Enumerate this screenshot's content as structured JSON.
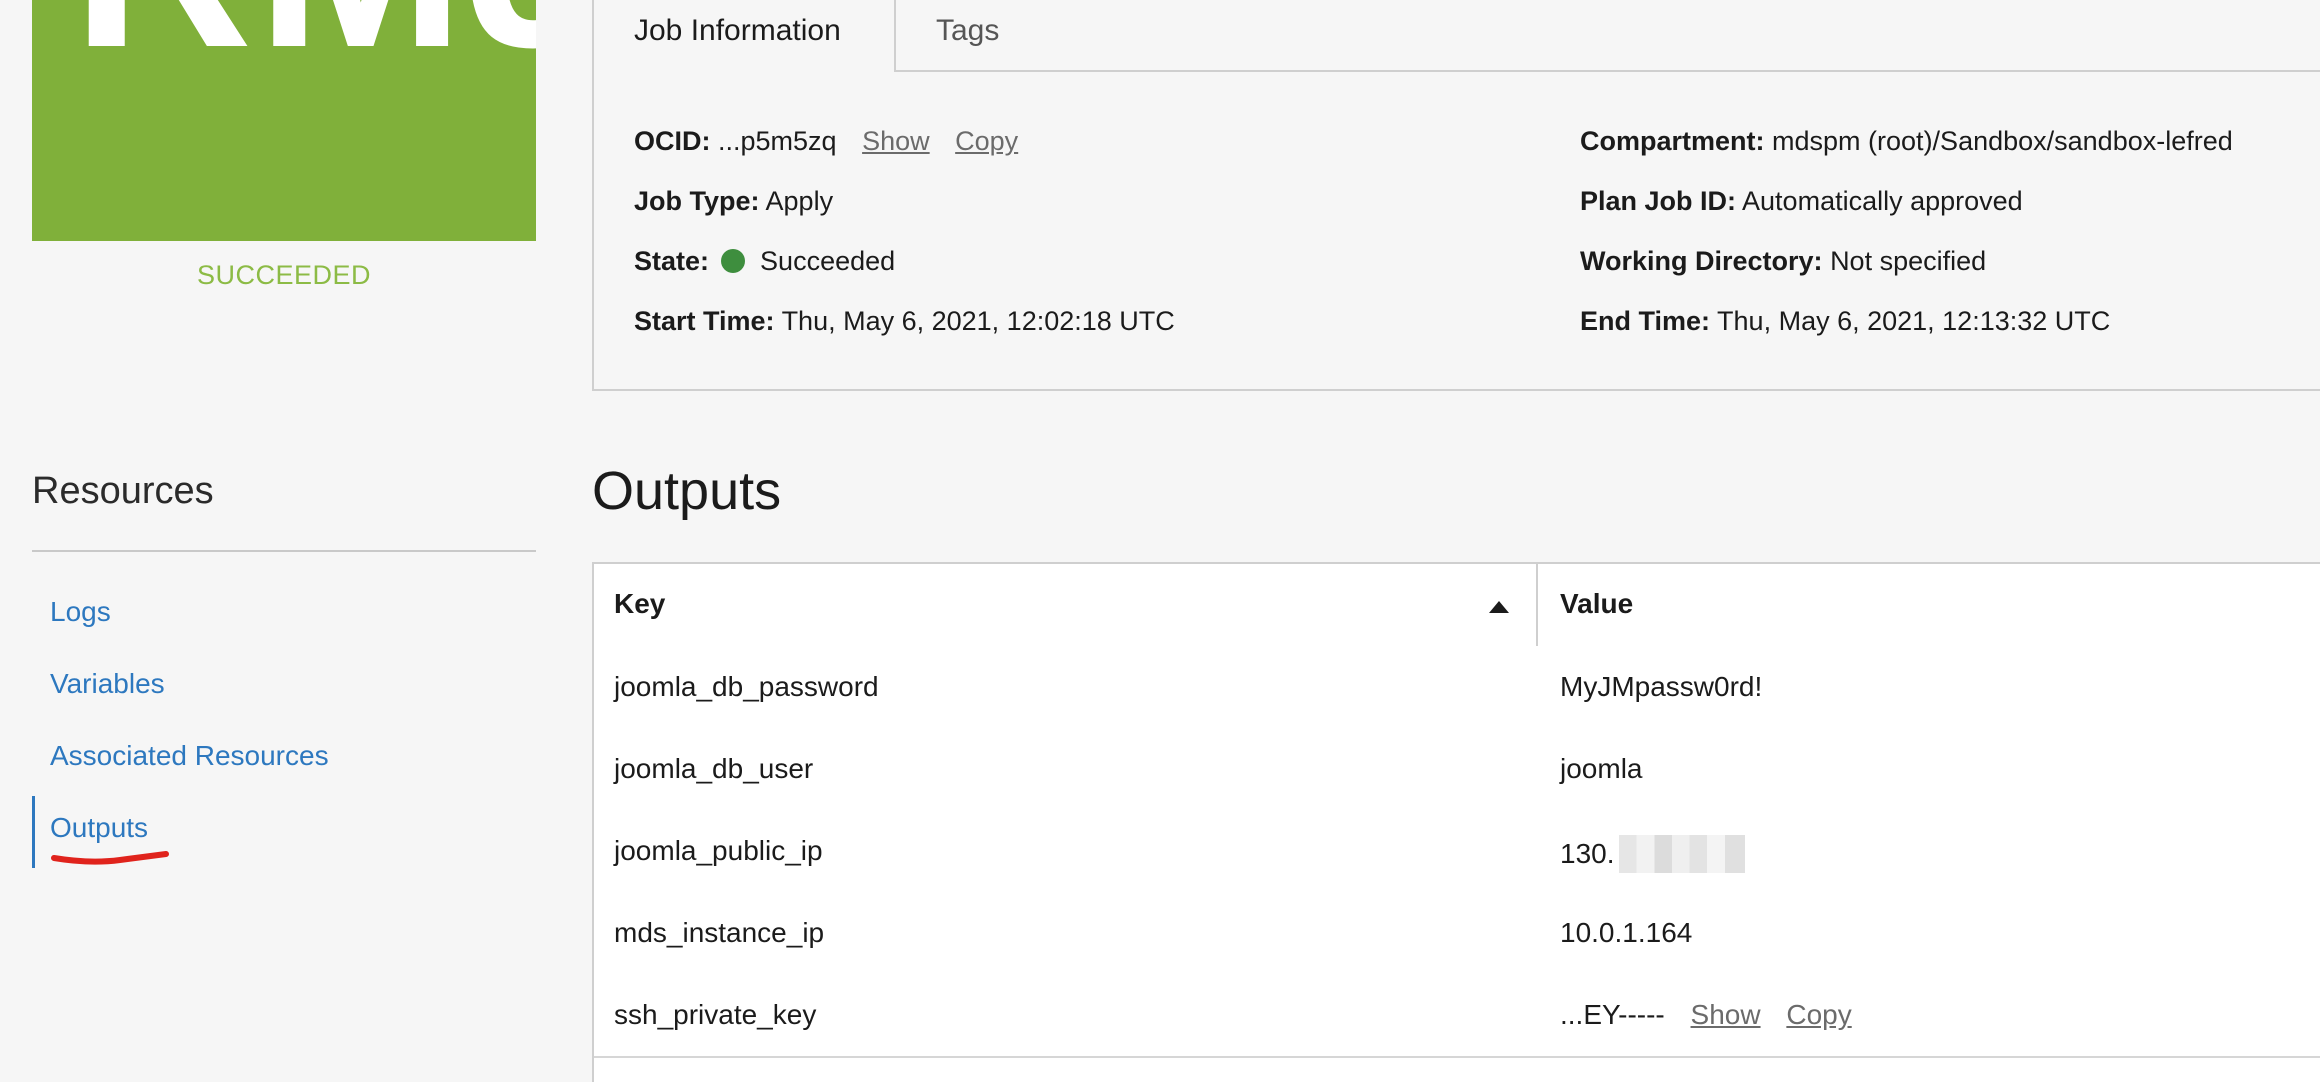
{
  "logo": {
    "text": "RMJ",
    "status": "SUCCEEDED"
  },
  "tabs": [
    {
      "label": "Job Information",
      "active": true
    },
    {
      "label": "Tags",
      "active": false
    }
  ],
  "job_info": {
    "ocid": {
      "label": "OCID:",
      "value": "...p5m5zq",
      "show": "Show",
      "copy": "Copy"
    },
    "job_type": {
      "label": "Job Type:",
      "value": "Apply"
    },
    "state": {
      "label": "State:",
      "value": "Succeeded",
      "color": "#3e8e3e"
    },
    "start_time": {
      "label": "Start Time:",
      "value": "Thu, May 6, 2021, 12:02:18 UTC"
    },
    "compartment": {
      "label": "Compartment:",
      "value": "mdspm (root)/Sandbox/sandbox-lefred"
    },
    "plan_job_id": {
      "label": "Plan Job ID:",
      "value": "Automatically approved"
    },
    "working_directory": {
      "label": "Working Directory:",
      "value": "Not specified"
    },
    "end_time": {
      "label": "End Time:",
      "value": "Thu, May 6, 2021, 12:13:32 UTC"
    }
  },
  "resources": {
    "title": "Resources",
    "items": [
      {
        "label": "Logs",
        "active": false
      },
      {
        "label": "Variables",
        "active": false
      },
      {
        "label": "Associated Resources",
        "active": false
      },
      {
        "label": "Outputs",
        "active": true
      }
    ]
  },
  "outputs": {
    "title": "Outputs",
    "columns": {
      "key": "Key",
      "value": "Value"
    },
    "sort": "ascending",
    "rows": [
      {
        "key": "joomla_db_password",
        "value": "MyJMpassw0rd!"
      },
      {
        "key": "joomla_db_user",
        "value": "joomla"
      },
      {
        "key": "joomla_public_ip",
        "value": "130."
      },
      {
        "key": "mds_instance_ip",
        "value": "10.0.1.164"
      },
      {
        "key": "ssh_private_key",
        "value": "...EY-----",
        "show": "Show",
        "copy": "Copy"
      }
    ]
  },
  "colors": {
    "brand_green": "#80b03a",
    "link_blue": "#2d78bf",
    "annotation_red": "#e0231c"
  }
}
